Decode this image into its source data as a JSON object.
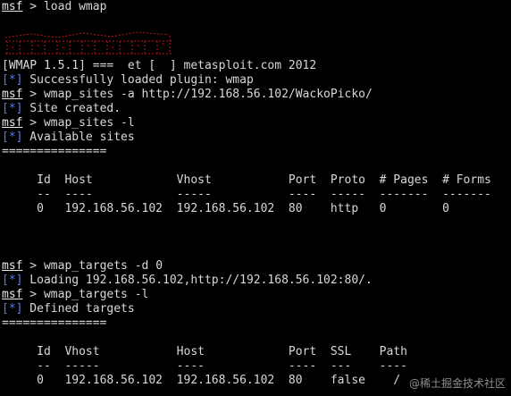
{
  "terminal": {
    "lines": [
      {
        "type": "cmd",
        "prompt": "msf",
        "text": " > load wmap"
      },
      {
        "type": "blank"
      },
      {
        "type": "banner"
      },
      {
        "type": "text",
        "text": "[WMAP 1.5.1] ===  et [  ] metasploit.com 2012"
      },
      {
        "type": "info",
        "tag": "[*]",
        "text": " Successfully loaded plugin: wmap"
      },
      {
        "type": "cmd",
        "prompt": "msf",
        "text": " > wmap_sites -a http://192.168.56.102/WackoPicko/"
      },
      {
        "type": "info",
        "tag": "[*]",
        "text": " Site created."
      },
      {
        "type": "cmd",
        "prompt": "msf",
        "text": " > wmap_sites -l"
      },
      {
        "type": "info",
        "tag": "[*]",
        "text": " Available sites"
      },
      {
        "type": "text",
        "text": "==============="
      },
      {
        "type": "blank"
      },
      {
        "type": "text",
        "text": "     Id  Host            Vhost           Port  Proto  # Pages  # Forms"
      },
      {
        "type": "text",
        "text": "     --  ----            -----           ----  -----  -------  -------"
      },
      {
        "type": "text",
        "text": "     0   192.168.56.102  192.168.56.102  80    http   0        0"
      },
      {
        "type": "blank"
      },
      {
        "type": "blank"
      },
      {
        "type": "blank"
      },
      {
        "type": "cmd",
        "prompt": "msf",
        "text": " > wmap_targets -d 0"
      },
      {
        "type": "info",
        "tag": "[*]",
        "text": " Loading 192.168.56.102,http://192.168.56.102:80/."
      },
      {
        "type": "cmd",
        "prompt": "msf",
        "text": " > wmap_targets -l"
      },
      {
        "type": "info",
        "tag": "[*]",
        "text": " Defined targets"
      },
      {
        "type": "text",
        "text": "==============="
      },
      {
        "type": "blank"
      },
      {
        "type": "text",
        "text": "     Id  Vhost           Host            Port  SSL    Path"
      },
      {
        "type": "text",
        "text": "     --  -----           ----            ----  ---    ----"
      },
      {
        "type": "text",
        "text": "     0   192.168.56.102  192.168.56.102  80    false    /"
      }
    ]
  },
  "colors": {
    "background": "#000000",
    "text": "#d8d8d8",
    "info_tag": "#4f7bff",
    "banner": "#c0141a"
  },
  "watermark": "@稀土掘金技术社区"
}
